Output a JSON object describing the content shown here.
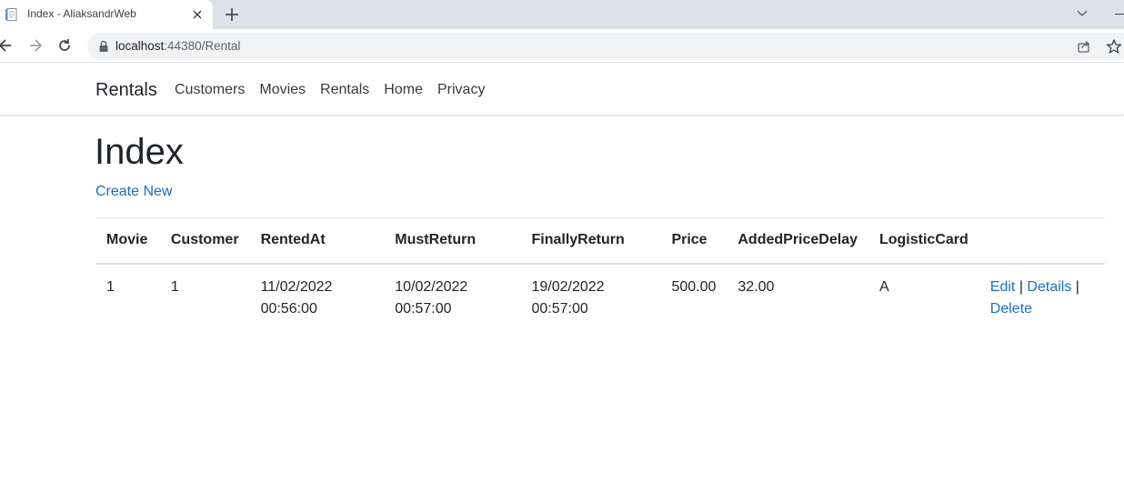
{
  "browser": {
    "tab_title": "Index - AliaksandrWeb",
    "url_host": "localhost",
    "url_port_path": ":44380/Rental"
  },
  "navbar": {
    "brand": "Rentals",
    "links": [
      "Customers",
      "Movies",
      "Rentals",
      "Home",
      "Privacy"
    ]
  },
  "page": {
    "title": "Index",
    "create_new": "Create New"
  },
  "table": {
    "columns": [
      "Movie",
      "Customer",
      "RentedAt",
      "MustReturn",
      "FinallyReturn",
      "Price",
      "AddedPriceDelay",
      "LogisticCard"
    ],
    "rows": [
      {
        "movie": "1",
        "customer": "1",
        "rented_at_date": "11/02/2022",
        "rented_at_time": "00:56:00",
        "must_return_date": "10/02/2022",
        "must_return_time": "00:57:00",
        "finally_return_date": "19/02/2022",
        "finally_return_time": "00:57:00",
        "price": "500.00",
        "added_price_delay": "32.00",
        "logistic_card": "A",
        "actions": {
          "edit": "Edit",
          "details": "Details",
          "delete": "Delete",
          "separator": "|"
        }
      }
    ]
  },
  "colors": {
    "link": "#1b6ec2",
    "text": "#212529",
    "border": "#dee2e6"
  }
}
